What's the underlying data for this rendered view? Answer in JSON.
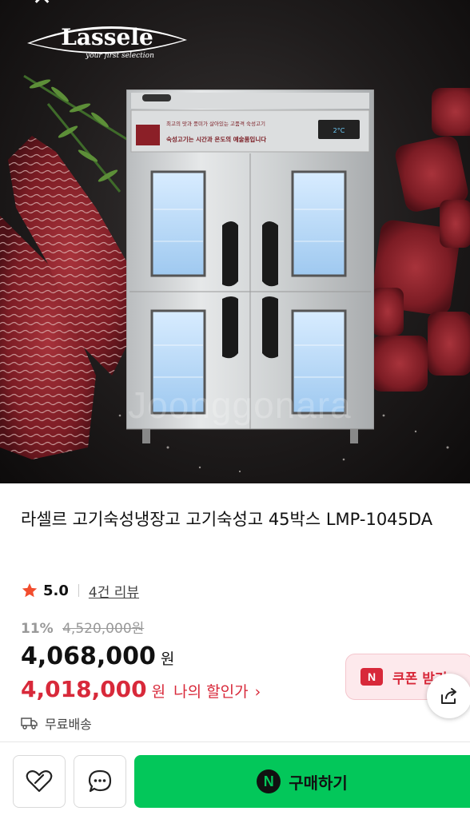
{
  "hero": {
    "brand_name": "Lassele",
    "brand_tagline": "your first selection",
    "watermark": "Joonggonara",
    "panel_text_1": "최고의 맛과 풍미가 살아있는 고품격 숙성고기",
    "panel_text_2": "숙성고기는 시간과 온도의 예술품입니다",
    "display_readout": "2°C"
  },
  "product": {
    "title": "라셀르 고기숙성냉장고 고기숙성고 45박스 LMP-1045DA",
    "rating": "5.0",
    "review_link": "4건 리뷰",
    "discount_percent": "11%",
    "original_price": "4,520,000원",
    "price": "4,068,000",
    "price_unit": "원",
    "my_price": "4,018,000",
    "my_price_unit": "원",
    "my_price_label": "나의 할인가",
    "my_price_chevron": "›",
    "shipping": "무료배송"
  },
  "coupon": {
    "badge": "N",
    "label": "쿠폰 받기"
  },
  "bottom": {
    "buy_label": "구매하기",
    "buy_badge": "N"
  },
  "colors": {
    "accent_red": "#d8293a",
    "buy_green": "#03c75a",
    "star": "#f24d2e"
  },
  "icons": [
    "close-icon",
    "star-icon",
    "coupon-n-icon",
    "share-icon",
    "truck-icon",
    "heart-icon",
    "chat-icon",
    "naver-n-icon"
  ]
}
